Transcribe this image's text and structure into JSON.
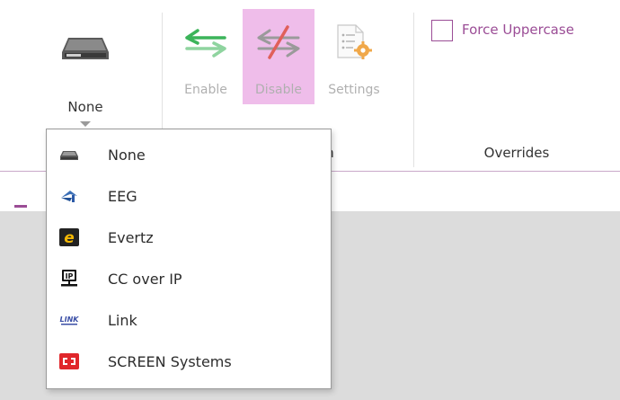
{
  "device": {
    "selected_label": "None",
    "icon": "hardware-device-icon"
  },
  "buttons": {
    "enable_label": "Enable",
    "disable_label": "Disable",
    "settings_label": "Settings"
  },
  "groups": {
    "second_label": "n",
    "overrides_label": "Overrides"
  },
  "force_uppercase_label": "Force Uppercase",
  "menu": {
    "items": [
      {
        "label": "None",
        "icon": "hardware-device-icon"
      },
      {
        "label": "EEG",
        "icon": "eeg-logo-icon"
      },
      {
        "label": "Evertz",
        "icon": "evertz-logo-icon"
      },
      {
        "label": "CC over IP",
        "icon": "ip-network-icon"
      },
      {
        "label": "Link",
        "icon": "link-electronics-logo-icon"
      },
      {
        "label": "SCREEN Systems",
        "icon": "screen-systems-logo-icon"
      }
    ]
  },
  "colors": {
    "accent": "#9b4d96",
    "active_button": "#efbdea",
    "enable_green": "#3cb45a",
    "disable_red": "#e0605a"
  }
}
